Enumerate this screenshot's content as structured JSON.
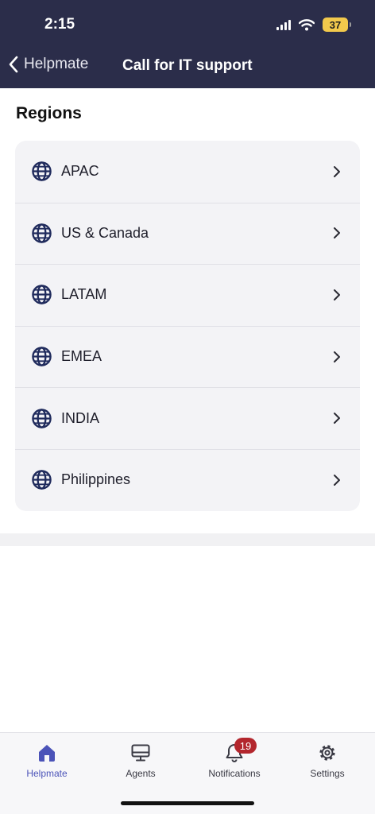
{
  "status_bar": {
    "time": "2:15",
    "battery": "37"
  },
  "nav": {
    "back_label": "Helpmate",
    "title": "Call for IT support"
  },
  "section": {
    "title": "Regions"
  },
  "regions": [
    {
      "label": "APAC",
      "icon": "globe-icon"
    },
    {
      "label": "US & Canada",
      "icon": "globe-icon"
    },
    {
      "label": "LATAM",
      "icon": "globe-icon"
    },
    {
      "label": "EMEA",
      "icon": "globe-icon"
    },
    {
      "label": "INDIA",
      "icon": "globe-icon"
    },
    {
      "label": "Philippines",
      "icon": "globe-icon"
    }
  ],
  "tabs": [
    {
      "label": "Helpmate",
      "icon": "home-icon",
      "active": true
    },
    {
      "label": "Agents",
      "icon": "monitor-icon"
    },
    {
      "label": "Notifications",
      "icon": "bell-icon",
      "badge": "19"
    },
    {
      "label": "Settings",
      "icon": "gear-icon"
    }
  ],
  "colors": {
    "header_bg": "#2b2d4a",
    "accent": "#4b53b8",
    "badge": "#b3262d",
    "globe": "#1f2a5c",
    "battery": "#f2c94c"
  }
}
